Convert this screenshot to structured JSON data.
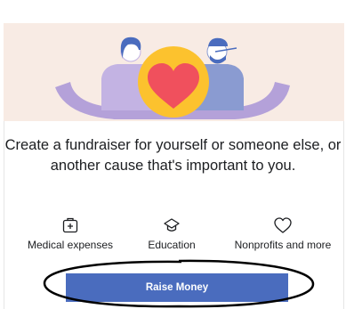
{
  "headline": "Create a fundraiser for yourself or someone else, or another cause that's important to you.",
  "features": [
    {
      "icon": "medical-kit-icon",
      "label": "Medical expenses"
    },
    {
      "icon": "graduation-cap-icon",
      "label": "Education"
    },
    {
      "icon": "heart-outline-icon",
      "label": "Nonprofits and more"
    }
  ],
  "cta": {
    "label": "Raise Money"
  },
  "colors": {
    "hero_bg": "#f8ebe4",
    "button_bg": "#4a6cbe",
    "heart_circle": "#fcc22e",
    "heart": "#f0505d",
    "figures": "#b4a1d9",
    "figure_dark": "#4a6cbe"
  },
  "annotation": {
    "type": "hand-drawn-ellipse",
    "target": "raise-money-button",
    "color": "#000000"
  }
}
